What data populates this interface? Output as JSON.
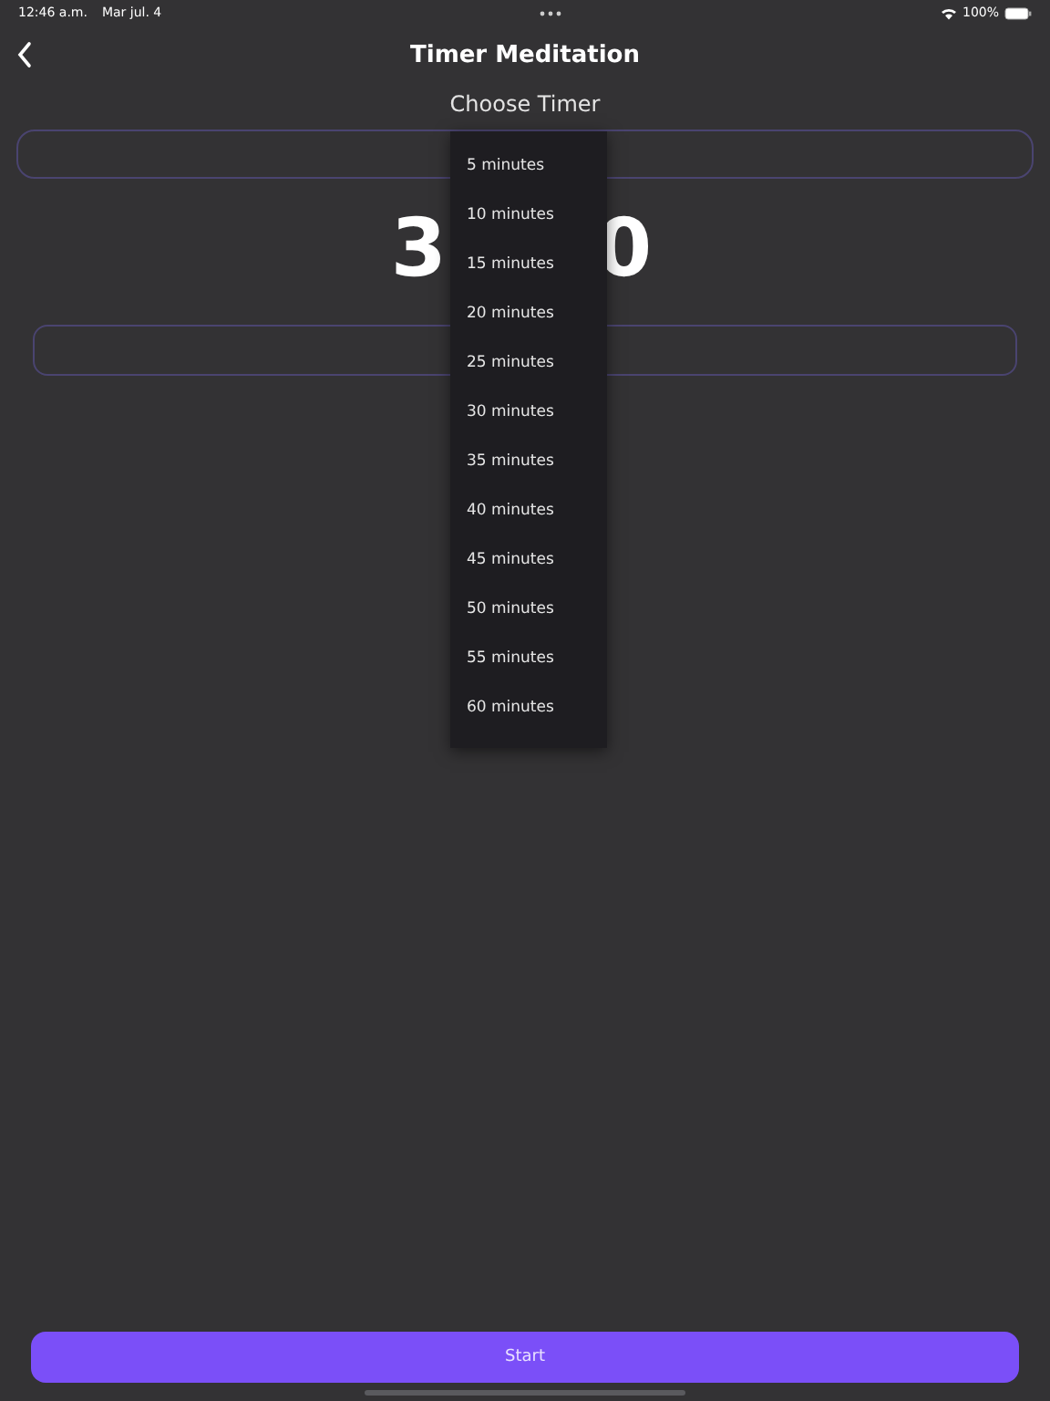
{
  "status_bar": {
    "time": "12:46 a.m.",
    "date": "Mar jul. 4",
    "battery": "100%"
  },
  "nav": {
    "title": "Timer Meditation"
  },
  "label": "Choose Timer",
  "timer": {
    "visible_parts": [
      "3",
      "0"
    ]
  },
  "dropdown": {
    "options": [
      {
        "label": "5 minutes"
      },
      {
        "label": "10 minutes"
      },
      {
        "label": "15 minutes"
      },
      {
        "label": "20 minutes"
      },
      {
        "label": "25 minutes"
      },
      {
        "label": "30 minutes"
      },
      {
        "label": "35 minutes"
      },
      {
        "label": "40 minutes"
      },
      {
        "label": "45 minutes"
      },
      {
        "label": "50 minutes"
      },
      {
        "label": "55 minutes"
      },
      {
        "label": "60 minutes"
      }
    ]
  },
  "start_button": {
    "label": "Start"
  }
}
